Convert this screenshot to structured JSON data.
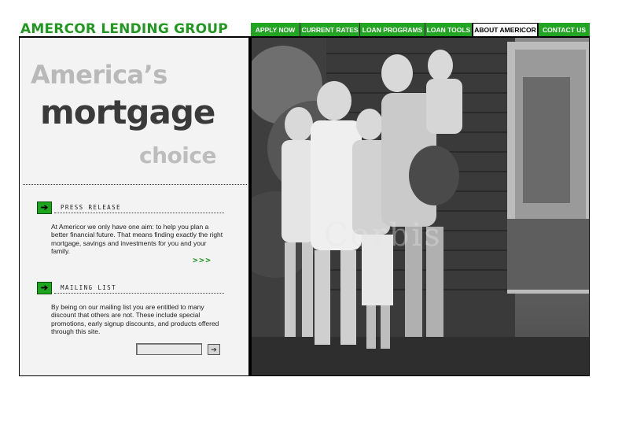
{
  "brand": {
    "name": "AMERCOR LENDING GROUP"
  },
  "nav": {
    "items": [
      {
        "label": "APPLY NOW"
      },
      {
        "label": "CURRENT RATES"
      },
      {
        "label": "LOAN PROGRAMS"
      },
      {
        "label": "LOAN TOOLS"
      },
      {
        "label": "ABOUT AMERICOR"
      },
      {
        "label": "CONTACT US"
      }
    ],
    "active_index": 4
  },
  "hero": {
    "line1": "America’s",
    "line2": "mortgage",
    "line3": "choice"
  },
  "press_release": {
    "title": "PRESS RELEASE",
    "body": "At Americor we only have one aim: to help you plan a better financial future. That means finding exactly the right mortgage, savings and investments for you and your family.",
    "more": ">>>"
  },
  "mailing_list": {
    "title": "MAILING LIST",
    "body": "By being on our mailing list you are entitled to many discount that others are not. These include special promotions, early signup discounts, and products offered through this site.",
    "email_value": ""
  },
  "photo": {
    "watermark": "Corbis"
  },
  "colors": {
    "brand_green": "#1f9a1f",
    "nav_green": "#22a522",
    "panel_bg": "#f3f3f3"
  },
  "icons": {
    "section_arrow": "arrow-right-icon",
    "submit": "arrow-right-icon"
  }
}
